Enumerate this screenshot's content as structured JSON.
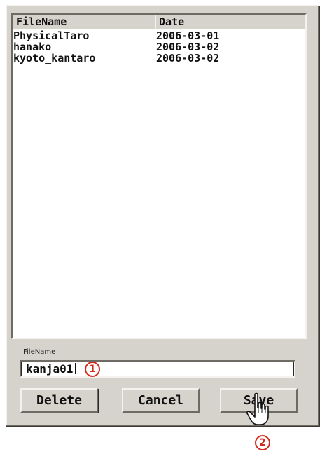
{
  "file_list": {
    "columns": [
      "FileName",
      "Date"
    ],
    "rows": [
      {
        "name": "PhysicalTaro",
        "date": "2006-03-01"
      },
      {
        "name": "hanako",
        "date": "2006-03-02"
      },
      {
        "name": "kyoto_kantaro",
        "date": "2006-03-02"
      }
    ]
  },
  "filename_field": {
    "label": "FileName",
    "value": "kanja01"
  },
  "buttons": {
    "delete": "Delete",
    "cancel": "Cancel",
    "save": "Save"
  },
  "callouts": {
    "step1": "1",
    "step2": "2"
  },
  "colors": {
    "panel": "#d6d2cc",
    "callout": "#d42a1e"
  },
  "icons": {
    "pointer": "hand-pointer-icon"
  }
}
